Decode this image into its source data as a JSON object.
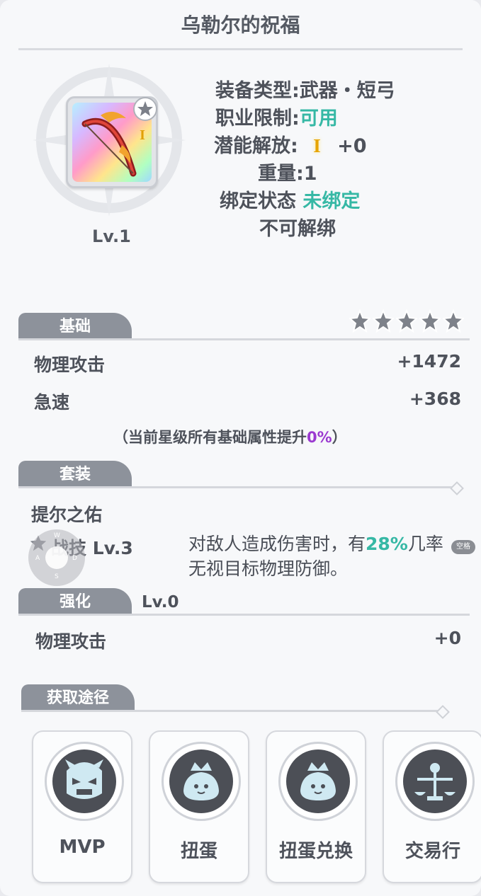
{
  "title": "乌勒尔的祝福",
  "item": {
    "level": "Lv.1",
    "rows": {
      "type_label": "装备类型:",
      "type_value": "武器・短弓",
      "job_label": "职业限制:",
      "job_value": "可用",
      "potential_label": "潜能解放:",
      "potential_icon": "I",
      "potential_value": "+0",
      "weight": "重量:1",
      "bind_label": "绑定状态",
      "bind_value": "未绑定",
      "unbind": "不可解绑"
    }
  },
  "basic": {
    "tab": "基础",
    "stars_filled": 0,
    "stars_total": 5,
    "stats": [
      {
        "name": "物理攻击",
        "value": "+1472"
      },
      {
        "name": "急速",
        "value": "+368"
      }
    ],
    "note_prefix": "（当前星级所有基础属性提升",
    "note_percent": "0%",
    "note_suffix": "）"
  },
  "set": {
    "tab": "套装",
    "name": "提尔之佑",
    "skill": "战技 Lv.3",
    "desc_part1": "对敌人造成伤害时，有",
    "desc_percent": "28%",
    "desc_part2": "几率",
    "desc_line2": "无视目标物理防御。"
  },
  "enhance": {
    "tab": "强化",
    "level": "Lv.0",
    "stats": [
      {
        "name": "物理攻击",
        "value": "+0"
      }
    ]
  },
  "sources": {
    "tab": "获取途径",
    "items": [
      {
        "label": "MVP",
        "icon": "mvp-demon-icon"
      },
      {
        "label": "扭蛋",
        "icon": "crowned-poring-icon"
      },
      {
        "label": "扭蛋兑换",
        "icon": "crowned-poring-icon"
      },
      {
        "label": "交易行",
        "icon": "trade-scale-icon"
      }
    ]
  },
  "overlay": {
    "joystick_keys": [
      "W",
      "A",
      "S",
      "D"
    ],
    "space": "空格"
  },
  "colors": {
    "accent_green": "#36b8a5",
    "accent_red": "#c92f4e",
    "accent_purple": "#9b3ad0",
    "tab_gray": "#8d929b"
  }
}
